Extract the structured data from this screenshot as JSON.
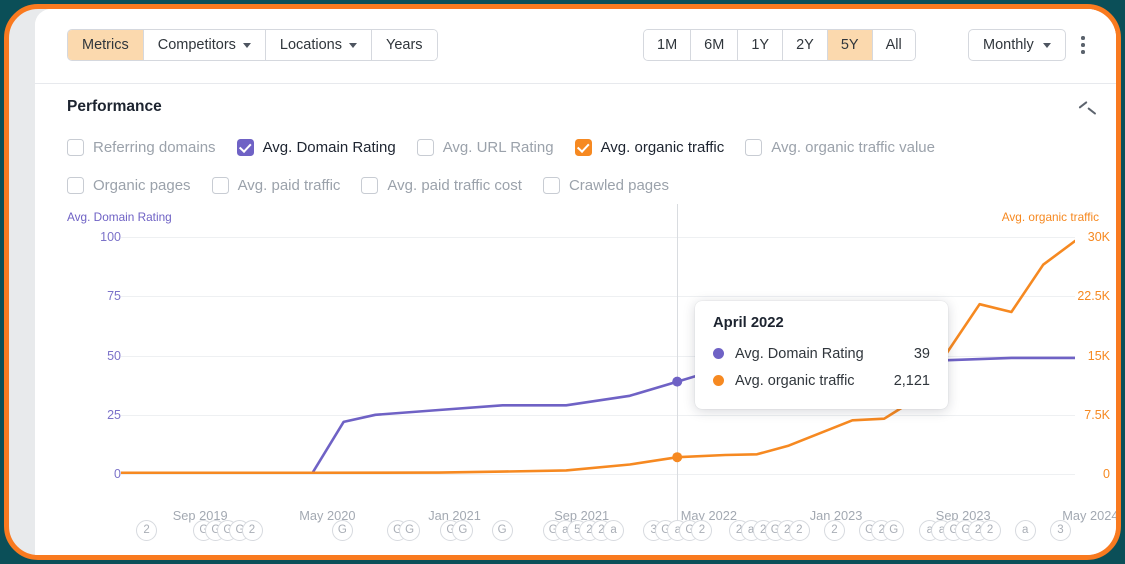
{
  "theme": {
    "frame_border": "#f97a1f",
    "page_backdrop": "#0b4f58",
    "accent_active": "#fbd9ae",
    "dr_color": "#6f62c5",
    "traffic_color": "#f68921"
  },
  "toolbar": {
    "tabs": [
      {
        "label": "Metrics",
        "active": true,
        "caret": false
      },
      {
        "label": "Competitors",
        "active": false,
        "caret": true
      },
      {
        "label": "Locations",
        "active": false,
        "caret": true
      },
      {
        "label": "Years",
        "active": false,
        "caret": false
      }
    ],
    "ranges": [
      {
        "label": "1M",
        "active": false
      },
      {
        "label": "6M",
        "active": false
      },
      {
        "label": "1Y",
        "active": false
      },
      {
        "label": "2Y",
        "active": false
      },
      {
        "label": "5Y",
        "active": true
      },
      {
        "label": "All",
        "active": false
      }
    ],
    "frequency": "Monthly",
    "more_menu": "more-options"
  },
  "section": {
    "title": "Performance",
    "collapse_state": "expanded"
  },
  "metrics": {
    "row1": [
      {
        "label": "Referring domains",
        "checked": false,
        "color": ""
      },
      {
        "label": "Avg. Domain Rating",
        "checked": true,
        "color": "#6f62c5"
      },
      {
        "label": "Avg. URL Rating",
        "checked": false,
        "color": ""
      },
      {
        "label": "Avg. organic traffic",
        "checked": true,
        "color": "#f68921"
      },
      {
        "label": "Avg. organic traffic value",
        "checked": false,
        "color": ""
      }
    ],
    "row2": [
      {
        "label": "Organic pages",
        "checked": false,
        "color": ""
      },
      {
        "label": "Avg. paid traffic",
        "checked": false,
        "color": ""
      },
      {
        "label": "Avg. paid traffic cost",
        "checked": false,
        "color": ""
      },
      {
        "label": "Crawled pages",
        "checked": false,
        "color": ""
      }
    ]
  },
  "tooltip": {
    "title": "April 2022",
    "rows": [
      {
        "name": "Avg. Domain Rating",
        "value": "39",
        "color": "#6f62c5"
      },
      {
        "name": "Avg. organic traffic",
        "value": "2,121",
        "color": "#f68921"
      }
    ]
  },
  "chart_data": {
    "type": "line",
    "title": "Performance",
    "xlabel": "",
    "grid": true,
    "legend": "checkbox-row",
    "axis_left": {
      "label": "Avg. Domain Rating",
      "color": "#6f62c5",
      "ticks": [
        "100",
        "75",
        "50",
        "25",
        "0"
      ],
      "ylim": [
        0,
        100
      ]
    },
    "axis_right": {
      "label": "Avg. organic traffic",
      "color": "#f68921",
      "ticks": [
        "30K",
        "22.5K",
        "15K",
        "7.5K",
        "0"
      ],
      "ylim": [
        0,
        30000
      ]
    },
    "x_ticks": [
      "Sep 2019",
      "May 2020",
      "Jan 2021",
      "Sep 2021",
      "May 2022",
      "Jan 2023",
      "Sep 2023",
      "May 2024"
    ],
    "x_range": [
      "May 2019",
      "May 2024"
    ],
    "highlight_x": "April 2022",
    "series": [
      {
        "name": "Avg. Domain Rating",
        "color": "#6f62c5",
        "axis": "left",
        "x": [
          "May 2019",
          "Sep 2019",
          "Jan 2020",
          "May 2020",
          "Jul 2020",
          "Sep 2020",
          "Jan 2021",
          "May 2021",
          "Sep 2021",
          "Jan 2022",
          "Apr 2022",
          "Jul 2022",
          "Sep 2022",
          "Jan 2023",
          "May 2023",
          "Sep 2023",
          "Jan 2024",
          "May 2024"
        ],
        "values": [
          0,
          0,
          0,
          0,
          22,
          25,
          27,
          29,
          29,
          33,
          39,
          45,
          47,
          47,
          48,
          48,
          49,
          49
        ]
      },
      {
        "name": "Avg. organic traffic",
        "color": "#f68921",
        "axis": "right",
        "x": [
          "May 2019",
          "Sep 2019",
          "Jan 2020",
          "May 2020",
          "Sep 2020",
          "Jan 2021",
          "May 2021",
          "Sep 2021",
          "Jan 2022",
          "Apr 2022",
          "Jul 2022",
          "Sep 2022",
          "Nov 2022",
          "Jan 2023",
          "Mar 2023",
          "May 2023",
          "Jul 2023",
          "Sep 2023",
          "Nov 2023",
          "Jan 2024",
          "Mar 2024",
          "May 2024"
        ],
        "values": [
          150,
          150,
          150,
          150,
          160,
          180,
          300,
          450,
          1200,
          2121,
          2400,
          2500,
          3600,
          5200,
          6800,
          7000,
          9500,
          15500,
          21500,
          20500,
          26500,
          29500
        ]
      }
    ],
    "event_badges": [
      {
        "label": "2",
        "x_pct": 3.0
      },
      {
        "label": "G",
        "x_pct": 14.4
      },
      {
        "label": "G",
        "x_pct": 16.8
      },
      {
        "label": "G",
        "x_pct": 19.2
      },
      {
        "label": "G",
        "x_pct": 21.6
      },
      {
        "label": "2",
        "x_pct": 24.0
      },
      {
        "label": "G",
        "x_pct": 42.0
      },
      {
        "label": "G",
        "x_pct": 53.0
      },
      {
        "label": "G",
        "x_pct": 55.4
      },
      {
        "label": "G",
        "x_pct": 63.6
      },
      {
        "label": "G",
        "x_pct": 66.0
      },
      {
        "label": "G",
        "x_pct": 73.8
      },
      {
        "label": "G",
        "x_pct": 84.0
      },
      {
        "label": "a",
        "x_pct": 86.4
      },
      {
        "label": "5",
        "x_pct": 88.8
      },
      {
        "label": "2",
        "x_pct": 91.2
      },
      {
        "label": "2",
        "x_pct": 93.6
      },
      {
        "label": "a",
        "x_pct": 96.0
      },
      {
        "label": "3",
        "x_pct": 104.0
      },
      {
        "label": "G",
        "x_pct": 106.4
      },
      {
        "label": "a",
        "x_pct": 108.8
      },
      {
        "label": "G",
        "x_pct": 111.2
      },
      {
        "label": "2",
        "x_pct": 113.6
      },
      {
        "label": "2",
        "x_pct": 121.0
      },
      {
        "label": "a",
        "x_pct": 123.4
      },
      {
        "label": "2",
        "x_pct": 125.8
      },
      {
        "label": "G",
        "x_pct": 128.2
      },
      {
        "label": "2",
        "x_pct": 130.6
      },
      {
        "label": "2",
        "x_pct": 133.0
      },
      {
        "label": "2",
        "x_pct": 140.0
      },
      {
        "label": "G",
        "x_pct": 147.0
      },
      {
        "label": "2",
        "x_pct": 149.4
      },
      {
        "label": "G",
        "x_pct": 151.8
      },
      {
        "label": "a",
        "x_pct": 159.0
      },
      {
        "label": "a",
        "x_pct": 161.4
      },
      {
        "label": "G",
        "x_pct": 163.8
      },
      {
        "label": "G",
        "x_pct": 166.2
      },
      {
        "label": "2",
        "x_pct": 168.6
      },
      {
        "label": "2",
        "x_pct": 171.0
      },
      {
        "label": "a",
        "x_pct": 178.0
      },
      {
        "label": "3",
        "x_pct": 185.0
      }
    ]
  }
}
